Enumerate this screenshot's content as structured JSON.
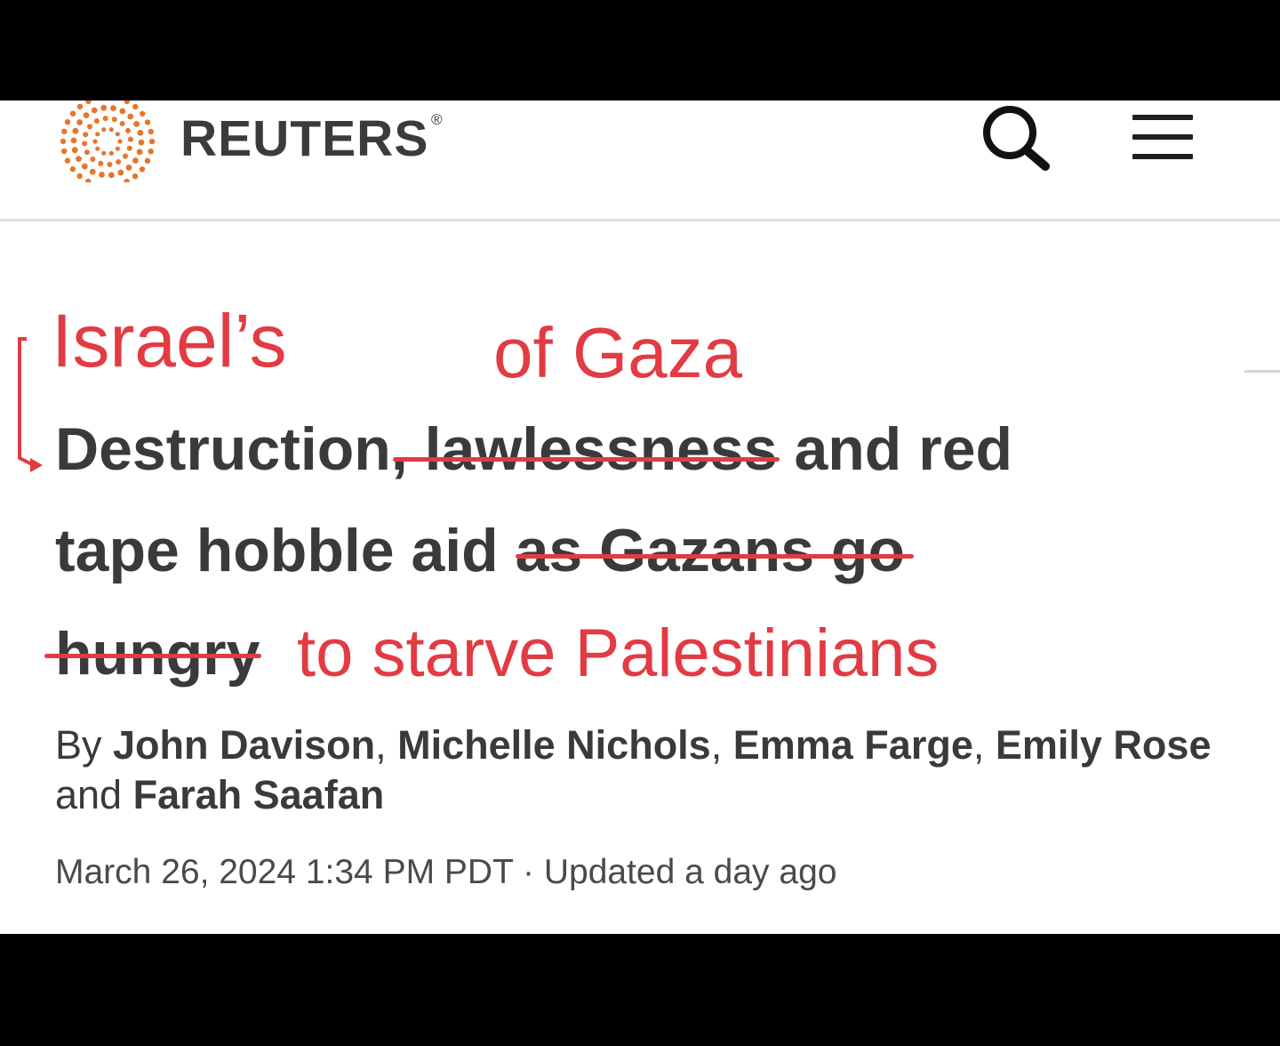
{
  "header": {
    "brand": "REUTERS",
    "brand_mark": "®",
    "logo_icon": "reuters-dot-sphere-logo",
    "search_icon": "search-icon",
    "menu_icon": "hamburger-menu-icon"
  },
  "annotations": {
    "israels": "Israel’s",
    "of_gaza": "of Gaza",
    "to_starve": "to starve Palestinians",
    "color": "#e23b43"
  },
  "headline": {
    "line1_a": "Destruction",
    "line1_struck": ", lawlessness",
    "line1_b": " and red",
    "line2_a": "tape hobble aid ",
    "line2_struck": "as Gazans go",
    "line3_struck": "hungry"
  },
  "byline": {
    "prefix": "By ",
    "author1": "John Davison",
    "sep1": ", ",
    "author2": "Michelle Nichols",
    "sep2": ", ",
    "author3": "Emma Farge",
    "sep3": ", ",
    "author4": "Emily Rose",
    "and": " and ",
    "author5": "Farah Saafan"
  },
  "dateline": "March 26, 2024 1:34 PM PDT · Updated a day ago",
  "colors": {
    "background": "#ffffff",
    "letterbox": "#000000",
    "logo_orange": "#e8752a",
    "text": "#3a3a3a"
  }
}
